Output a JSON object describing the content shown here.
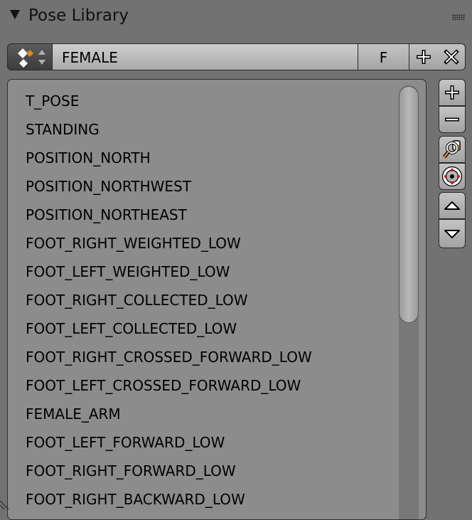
{
  "panel": {
    "title": "Pose Library"
  },
  "library": {
    "name": "FEMALE",
    "fake_user": "F",
    "type_icon": "armature-pose-icon",
    "add_icon": "plus-icon",
    "unlink_icon": "close-icon"
  },
  "poses": [
    "T_POSE",
    "STANDING",
    "POSITION_NORTH",
    "POSITION_NORTHWEST",
    "POSITION_NORTHEAST",
    "FOOT_RIGHT_WEIGHTED_LOW",
    "FOOT_LEFT_WEIGHTED_LOW",
    "FOOT_RIGHT_COLLECTED_LOW",
    "FOOT_LEFT_COLLECTED_LOW",
    "FOOT_RIGHT_CROSSED_FORWARD_LOW",
    "FOOT_LEFT_CROSSED_FORWARD_LOW",
    "FEMALE_ARM",
    "FOOT_LEFT_FORWARD_LOW",
    "FOOT_RIGHT_FORWARD_LOW",
    "FOOT_RIGHT_BACKWARD_LOW"
  ],
  "side_tools": [
    "add-pose-icon",
    "remove-pose-icon",
    "browse-poses-icon",
    "sanitize-icon",
    "move-up-icon",
    "move-down-icon"
  ],
  "colors": {
    "panel_bg": "#727272",
    "list_bg": "#8c8c8c",
    "accent_orange": "#e08a20",
    "accent_red": "#c81e1e"
  }
}
